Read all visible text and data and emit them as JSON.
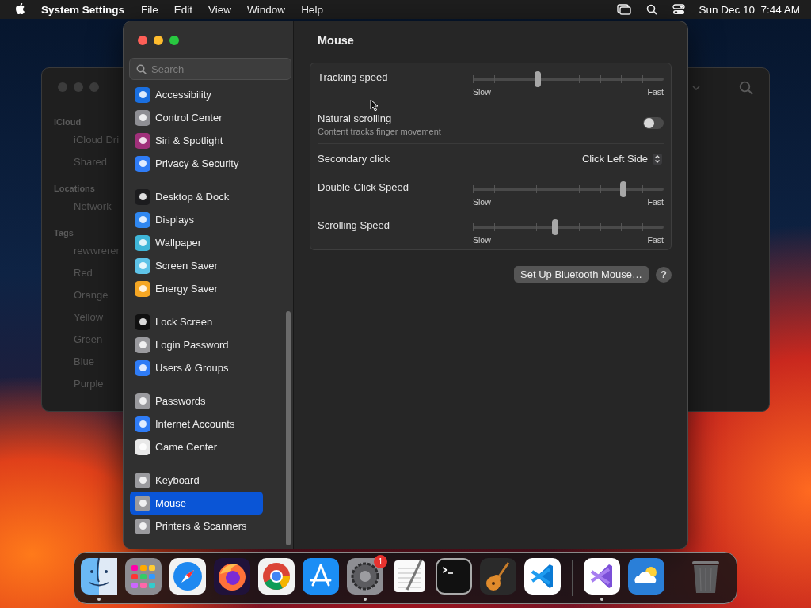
{
  "menu_bar": {
    "app": "System Settings",
    "menus": [
      "File",
      "Edit",
      "View",
      "Window",
      "Help"
    ],
    "clock": "Sun Dec 10  7:44 AM"
  },
  "finder_window": {
    "sidebar": [
      {
        "heading": "iCloud",
        "items": [
          "iCloud Dri",
          "Shared"
        ]
      },
      {
        "heading": "Locations",
        "items": [
          "Network"
        ]
      },
      {
        "heading": "Tags",
        "items": [
          "rewwrerer",
          "Red",
          "Orange",
          "Yellow",
          "Green",
          "Blue",
          "Purple"
        ]
      }
    ]
  },
  "settings_window": {
    "search": {
      "placeholder": "Search"
    },
    "sidebar": [
      [
        {
          "label": "Accessibility",
          "color": "#1a6fe0",
          "selected": false
        },
        {
          "label": "Control Center",
          "color": "#8e8e93",
          "selected": false
        },
        {
          "label": "Siri & Spotlight",
          "color": "#a0307a",
          "selected": false
        },
        {
          "label": "Privacy & Security",
          "color": "#2f7cf6",
          "selected": false
        }
      ],
      [
        {
          "label": "Desktop & Dock",
          "color": "#1c1c1e",
          "selected": false
        },
        {
          "label": "Displays",
          "color": "#2f87f0",
          "selected": false
        },
        {
          "label": "Wallpaper",
          "color": "#3fb6d8",
          "selected": false
        },
        {
          "label": "Screen Saver",
          "color": "#5ec3e8",
          "selected": false
        },
        {
          "label": "Energy Saver",
          "color": "#f5a623",
          "selected": false
        }
      ],
      [
        {
          "label": "Lock Screen",
          "color": "#111111",
          "selected": false
        },
        {
          "label": "Login Password",
          "color": "#9a9a9e",
          "selected": false
        },
        {
          "label": "Users & Groups",
          "color": "#2f7cf6",
          "selected": false
        }
      ],
      [
        {
          "label": "Passwords",
          "color": "#9a9a9e",
          "selected": false
        },
        {
          "label": "Internet Accounts",
          "color": "#2f7cf6",
          "selected": false
        },
        {
          "label": "Game Center",
          "color": "#e8e8e8",
          "selected": false
        }
      ],
      [
        {
          "label": "Keyboard",
          "color": "#9a9a9e",
          "selected": false
        },
        {
          "label": "Mouse",
          "color": "#9a9a9e",
          "selected": true
        },
        {
          "label": "Printers & Scanners",
          "color": "#9a9a9e",
          "selected": false
        }
      ]
    ],
    "title": "Mouse",
    "settings": [
      {
        "kind": "slider",
        "label": "Tracking speed",
        "level": 0.34,
        "min_label": "Slow",
        "max_label": "Fast"
      },
      {
        "kind": "toggle",
        "label": "Natural scrolling",
        "description": "Content tracks finger movement",
        "on": false
      },
      {
        "kind": "popup",
        "label": "Secondary click",
        "value": "Click Left Side"
      },
      {
        "kind": "slider",
        "label": "Double-Click Speed",
        "level": 0.79,
        "min_label": "Slow",
        "max_label": "Fast"
      },
      {
        "kind": "slider",
        "label": "Scrolling Speed",
        "level": 0.43,
        "min_label": "Slow",
        "max_label": "Fast"
      }
    ],
    "button": "Set Up Bluetooth Mouse…",
    "help": "?"
  },
  "dock": [
    [
      {
        "kind": "finder",
        "running": true
      },
      {
        "kind": "launchpad",
        "running": false
      },
      {
        "kind": "safari",
        "running": false
      },
      {
        "kind": "firefox",
        "running": false
      },
      {
        "kind": "chrome",
        "running": false
      },
      {
        "kind": "appstore",
        "running": false
      },
      {
        "kind": "settings",
        "running": true,
        "badge": "1"
      },
      {
        "kind": "textedit",
        "running": false
      },
      {
        "kind": "terminal",
        "running": false
      },
      {
        "kind": "garageband",
        "running": false
      },
      {
        "kind": "vscode",
        "running": false
      }
    ],
    [
      {
        "kind": "visualstudio",
        "running": true
      },
      {
        "kind": "weather",
        "running": false
      }
    ],
    [
      {
        "kind": "trash",
        "running": false
      }
    ]
  ]
}
